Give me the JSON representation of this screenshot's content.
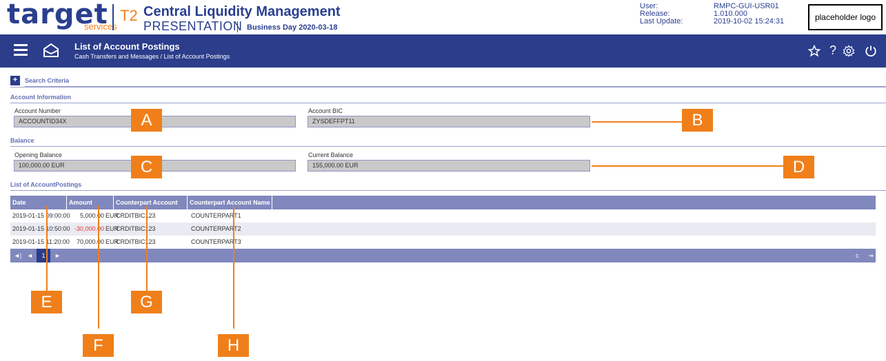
{
  "header": {
    "logo_text": "target",
    "logo_sub": "services",
    "logo_t2": "T2",
    "app_title": "Central Liquidity Management",
    "environment": "PRESENTATION",
    "business_day": "Business Day 2020-03-18",
    "meta": {
      "user_label": "User:",
      "release_label": "Release:",
      "update_label": "Last Update:",
      "user": "RMPC-GUI-USR01",
      "release": "1.010.000",
      "last_update": "2019-10-02 15:24:31"
    },
    "placeholder_logo": "placeholder logo"
  },
  "navbar": {
    "title": "List of Account Postings",
    "breadcrumb": "Cash Transfers and Messages  /  List of Account Postings",
    "icons": [
      "star-icon",
      "help-icon",
      "settings-icon",
      "power-icon"
    ],
    "help_glyph": "?"
  },
  "search": {
    "plus": "+",
    "label": "Search Criteria"
  },
  "account_info": {
    "section_label": "Account Information",
    "account_number_label": "Account Number",
    "account_number": "ACCOUNTID34X",
    "account_bic_label": "Account BIC",
    "account_bic": "ZYSDEFFPT11"
  },
  "balance": {
    "section_label": "Balance",
    "opening_label": "Opening Balance",
    "opening": "100,000.00 EUR",
    "current_label": "Current Balance",
    "current": "155,000.00 EUR"
  },
  "postings": {
    "section_label": "List of AccountPostings",
    "columns": [
      "Date",
      "Amount",
      "Counterpart Account BIC",
      "Counterpart Account Name"
    ],
    "rows": [
      {
        "date": "2019-01-15 09:00:00",
        "amount": "5,000.00",
        "currency": "EUR",
        "bic": "CRDITBIC123",
        "name": "COUNTERPART1",
        "negative": false
      },
      {
        "date": "2019-01-15 10:50:00",
        "amount": "-30,000.00",
        "currency": "EUR",
        "bic": "CRDITBIC123",
        "name": "COUNTERPART2",
        "negative": true
      },
      {
        "date": "2019-01-15 11:20:00",
        "amount": "70,000.00",
        "currency": "EUR",
        "bic": "CRDITBIC123",
        "name": "COUNTERPART3",
        "negative": false
      }
    ],
    "pager": {
      "first": "◄|",
      "prev": "◄",
      "page": "1",
      "next": "►",
      "refresh": "c",
      "export": "⇥"
    }
  },
  "callouts": [
    "A",
    "B",
    "C",
    "D",
    "E",
    "F",
    "G",
    "H"
  ],
  "colors": {
    "brand_blue": "#2b3d8b",
    "accent_orange": "#f07f1a",
    "table_header": "#8088bd",
    "negative": "#dd3333"
  }
}
